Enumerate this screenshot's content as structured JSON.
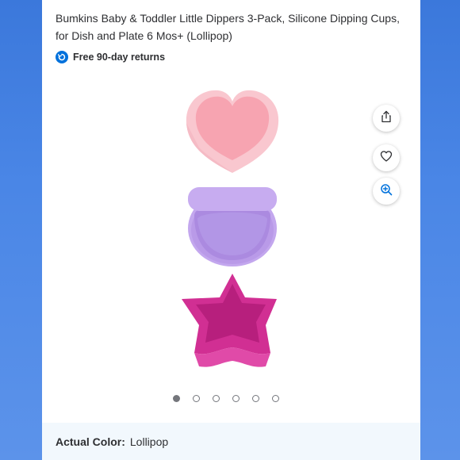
{
  "product": {
    "title": "Bumkins Baby & Toddler Little Dippers 3-Pack, Silicone Dipping Cups, for Dish and Plate 6 Mos+ (Lollipop)",
    "returns_label": "Free 90-day returns"
  },
  "gallery": {
    "cups": [
      {
        "shape": "heart",
        "color": "#f5a3b0"
      },
      {
        "shape": "round",
        "color": "#b79ae6"
      },
      {
        "shape": "star",
        "color": "#d9339a"
      }
    ],
    "actions": [
      {
        "icon": "share-icon"
      },
      {
        "icon": "heart-icon"
      },
      {
        "icon": "zoom-in-icon"
      }
    ],
    "slide_count": 6,
    "active_slide": 1
  },
  "color": {
    "label": "Actual Color:",
    "value": "Lollipop"
  },
  "colors": {
    "accent": "#0071dc",
    "page_bg": "#4a86e6",
    "panel_bg": "#f2f8fd"
  }
}
